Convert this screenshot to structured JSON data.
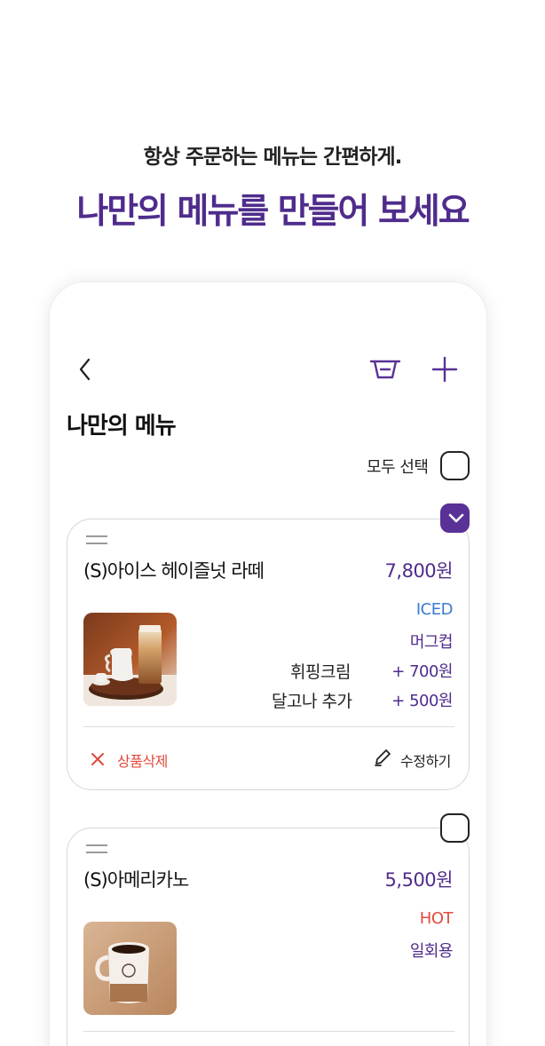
{
  "promo": {
    "subtitle": "항상 주문하는 메뉴는 간편하게.",
    "title": "나만의 메뉴를 만들어 보세요"
  },
  "header": {
    "back_icon": "chevron-left-icon",
    "basket_icon": "basket-icon",
    "add_icon": "plus-icon",
    "title": "나만의 메뉴"
  },
  "select_all": {
    "label": "모두 선택",
    "checked": false
  },
  "items": [
    {
      "name": "(S)아이스 헤이즐넛 라떼",
      "price": "7,800원",
      "checked": true,
      "temperature": "ICED",
      "cup": "머그컵",
      "extras": [
        {
          "label": "휘핑크림",
          "price": "+ 700원"
        },
        {
          "label": "달고나 추가",
          "price": "+ 500원"
        }
      ],
      "delete_label": "상품삭제",
      "edit_label": "수정하기"
    },
    {
      "name": "(S)아메리카노",
      "price": "5,500원",
      "checked": false,
      "temperature": "HOT",
      "cup": "일회용"
    }
  ],
  "colors": {
    "brand_purple": "#4f2c8c",
    "iced_blue": "#3b7bd1",
    "hot_red": "#e04a3d",
    "delete_red": "#e04a3d"
  }
}
